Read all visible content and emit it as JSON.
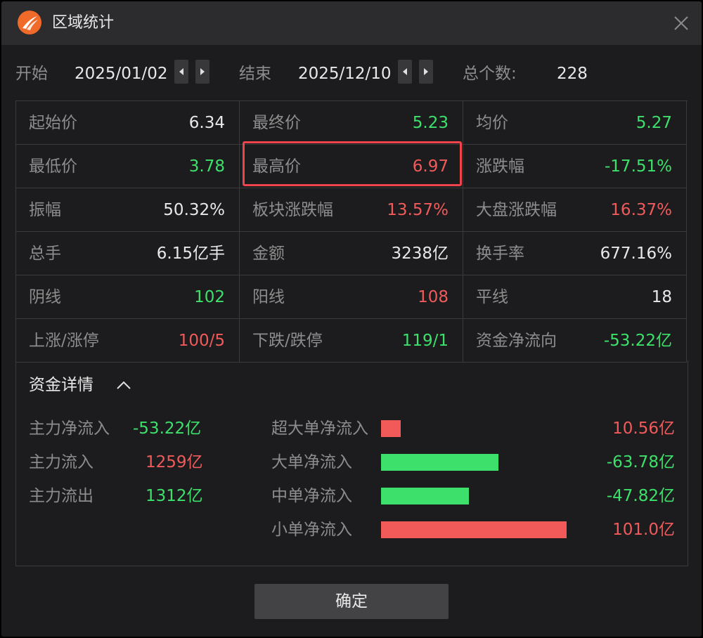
{
  "window": {
    "title": "区域统计"
  },
  "toolbar": {
    "start_label": "开始",
    "start_date": "2025/01/02",
    "end_label": "结束",
    "end_date": "2025/12/10",
    "count_label": "总个数:",
    "count_value": "228"
  },
  "stats": [
    [
      {
        "label": "起始价",
        "value": "6.34",
        "color": "white"
      },
      {
        "label": "最终价",
        "value": "5.23",
        "color": "green"
      },
      {
        "label": "均价",
        "value": "5.27",
        "color": "green"
      }
    ],
    [
      {
        "label": "最低价",
        "value": "3.78",
        "color": "green"
      },
      {
        "label": "最高价",
        "value": "6.97",
        "color": "red"
      },
      {
        "label": "涨跌幅",
        "value": "-17.51%",
        "color": "green"
      }
    ],
    [
      {
        "label": "振幅",
        "value": "50.32%",
        "color": "white"
      },
      {
        "label": "板块涨跌幅",
        "value": "13.57%",
        "color": "red"
      },
      {
        "label": "大盘涨跌幅",
        "value": "16.37%",
        "color": "red"
      }
    ],
    [
      {
        "label": "总手",
        "value": "6.15亿手",
        "color": "white"
      },
      {
        "label": "金额",
        "value": "3238亿",
        "color": "white"
      },
      {
        "label": "换手率",
        "value": "677.16%",
        "color": "white"
      }
    ],
    [
      {
        "label": "阴线",
        "value": "102",
        "color": "green"
      },
      {
        "label": "阳线",
        "value": "108",
        "color": "red"
      },
      {
        "label": "平线",
        "value": "18",
        "color": "white"
      }
    ],
    [
      {
        "label": "上涨/涨停",
        "value": "100/5",
        "color": "red"
      },
      {
        "label": "下跌/跌停",
        "value": "119/1",
        "color": "green"
      },
      {
        "label": "资金净流向",
        "value": "-53.22亿",
        "color": "green"
      }
    ]
  ],
  "capital": {
    "title": "资金详情",
    "summary": [
      {
        "label": "主力净流入",
        "value": "-53.22亿",
        "color": "green"
      },
      {
        "label": "主力流入",
        "value": "1259亿",
        "color": "red"
      },
      {
        "label": "主力流出",
        "value": "1312亿",
        "color": "green"
      }
    ],
    "flows": [
      {
        "label": "超大单净流入",
        "value": "10.56亿",
        "amount": 10.56
      },
      {
        "label": "大单净流入",
        "value": "-63.78亿",
        "amount": -63.78
      },
      {
        "label": "中单净流入",
        "value": "-47.82亿",
        "amount": -47.82
      },
      {
        "label": "小单净流入",
        "value": "101.0亿",
        "amount": 101.0
      }
    ]
  },
  "buttons": {
    "ok": "确定"
  },
  "colors": {
    "red": "#f05a5a",
    "green": "#3de06a",
    "white": "#e8e8e8",
    "accent": "#f0444c"
  }
}
